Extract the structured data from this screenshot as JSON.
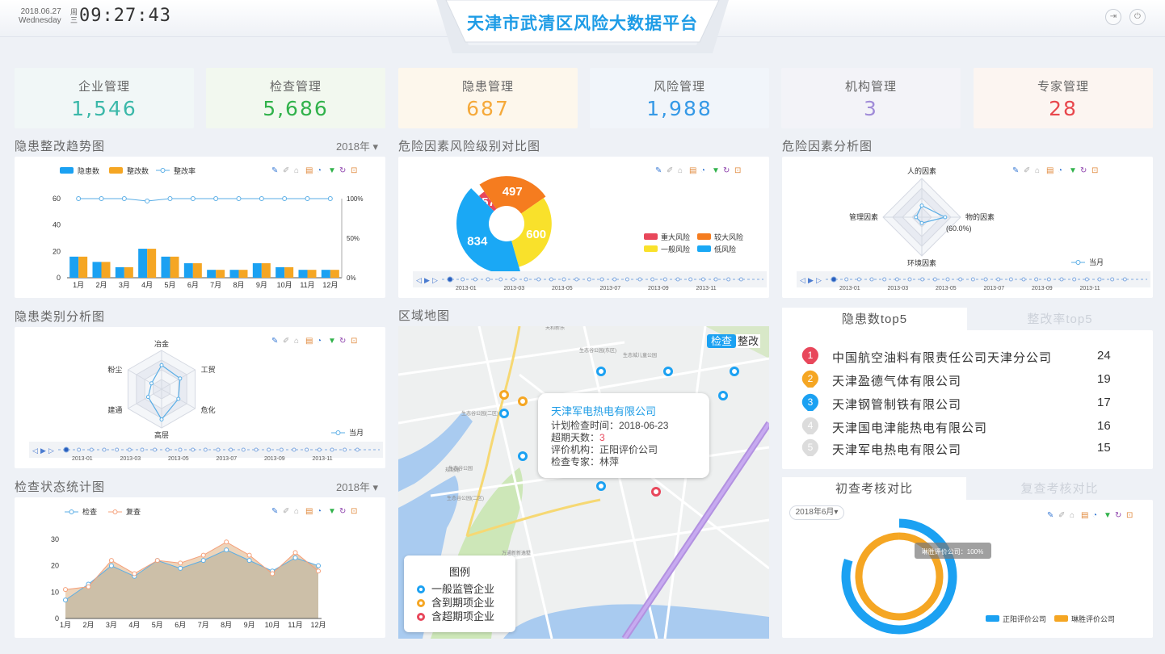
{
  "header": {
    "date": "2018.06.27",
    "weekday_en": "Wednesday",
    "weekday_cn": "周三",
    "time": "09:27:43",
    "title": "天津市武清区风险大数据平台"
  },
  "stats": [
    {
      "label": "企业管理",
      "value": "1,546",
      "color": "#3bb8a9",
      "bg": "#f1f7f7"
    },
    {
      "label": "检查管理",
      "value": "5,686",
      "color": "#31b24b",
      "bg": "#f2f8ef"
    },
    {
      "label": "隐患管理",
      "value": "687",
      "color": "#f5a93a",
      "bg": "#fdf7ec"
    },
    {
      "label": "风险管理",
      "value": "1,988",
      "color": "#3599e6",
      "bg": "#f1f5fa"
    },
    {
      "label": "机构管理",
      "value": "3",
      "color": "#a08bd8",
      "bg": "#f3f3f8"
    },
    {
      "label": "专家管理",
      "value": "28",
      "color": "#e8474d",
      "bg": "#fcf5f1"
    }
  ],
  "sections": {
    "trend": "隐患整改趋势图",
    "trend_year": "2018年",
    "risk_level": "危险因素风险级别对比图",
    "factor": "危险因素分析图",
    "category": "隐患类别分析图",
    "area_map": "区域地图",
    "inspect": "检查状态统计图",
    "inspect_year": "2018年"
  },
  "timeline_ticks": [
    "2013-01",
    "2013-03",
    "2013-05",
    "2013-07",
    "2013-09",
    "2013-11"
  ],
  "chart_data": [
    {
      "type": "bar",
      "title": "",
      "categories": [
        "1月",
        "2月",
        "3月",
        "4月",
        "5月",
        "6月",
        "7月",
        "8月",
        "9月",
        "10月",
        "11月",
        "12月"
      ],
      "series": [
        {
          "name": "隐患数",
          "values": [
            16,
            12,
            8,
            22,
            16,
            11,
            6,
            6,
            11,
            8,
            6,
            6
          ],
          "color": "#1ba1f2"
        },
        {
          "name": "整改数",
          "values": [
            16,
            12,
            8,
            22,
            16,
            11,
            6,
            6,
            11,
            8,
            6,
            6
          ],
          "color": "#f5a623"
        },
        {
          "name": "整改率",
          "type": "line",
          "axis": "right",
          "values": [
            100,
            100,
            100,
            97,
            100,
            100,
            100,
            100,
            100,
            100,
            100,
            100
          ],
          "color": "#5aaee6"
        }
      ],
      "y_ticks": [
        0,
        20,
        40,
        60
      ],
      "ylim": [
        0,
        60
      ],
      "y2_ticks": [
        "0%",
        "50%",
        "100%"
      ],
      "y2lim": [
        0,
        100
      ],
      "legend": "top-center"
    },
    {
      "type": "pie",
      "title": "",
      "slices": [
        {
          "name": "重大风险",
          "value": 57,
          "color": "#e8475b"
        },
        {
          "name": "较大风险",
          "value": 497,
          "color": "#f57c1f"
        },
        {
          "name": "一般风险",
          "value": 600,
          "color": "#f9e12b"
        },
        {
          "name": "低风险",
          "value": 834,
          "color": "#1aa8f5"
        }
      ],
      "legend": "right"
    },
    {
      "type": "radar",
      "title": "",
      "indicators": [
        "人的因素",
        "物的因素",
        "环境因素",
        "管理因素"
      ],
      "annotation": "(60.0%)",
      "series": [
        {
          "name": "当月",
          "values": [
            0.3,
            0.6,
            0.15,
            0.15
          ]
        }
      ],
      "legend": "bottom-right"
    },
    {
      "type": "radar",
      "title": "",
      "indicators": [
        "冶金",
        "工贸",
        "危化",
        "高层",
        "建通",
        "粉尘"
      ],
      "series": [
        {
          "name": "当月",
          "values": [
            0.62,
            0.55,
            0.5,
            0.78,
            0.4,
            0.3
          ]
        }
      ],
      "legend": "bottom-right"
    },
    {
      "type": "area",
      "title": "",
      "categories": [
        "1月",
        "2月",
        "3月",
        "4月",
        "5月",
        "6月",
        "7月",
        "8月",
        "9月",
        "10月",
        "11月",
        "12月"
      ],
      "series": [
        {
          "name": "检查",
          "values": [
            7,
            13,
            20,
            16,
            22,
            19,
            22,
            26,
            22,
            18,
            23,
            20
          ],
          "color": "#5aaee6"
        },
        {
          "name": "复查",
          "values": [
            11,
            12,
            22,
            17,
            22,
            21,
            24,
            29,
            24,
            17,
            25,
            18
          ],
          "color": "#f5a07a"
        }
      ],
      "y_ticks": [
        0,
        10,
        20,
        30
      ],
      "ylim": [
        0,
        30
      ],
      "legend": "top-left"
    },
    {
      "type": "pie",
      "title": "",
      "slices": [
        {
          "name": "正阳评价公司",
          "value": 80,
          "color": "#1ba1f2"
        },
        {
          "name": "琳胜评价公司",
          "value": 100,
          "color": "#f5a623"
        }
      ],
      "tooltip": "琳胜评价公司：100%",
      "legend": "bottom-right"
    }
  ],
  "top5_tabs": {
    "active": "隐患数top5",
    "inactive": "整改率top5"
  },
  "top5": [
    {
      "rank": "1",
      "name": "中国航空油料有限责任公司天津分公司",
      "value": "24",
      "color": "#e8475b"
    },
    {
      "rank": "2",
      "name": "天津盈德气体有限公司",
      "value": "19",
      "color": "#f5a623"
    },
    {
      "rank": "3",
      "name": "天津钢管制铁有限公司",
      "value": "17",
      "color": "#1ba1f2"
    },
    {
      "rank": "4",
      "name": "天津国电津能热电有限公司",
      "value": "16",
      "color": "#dcdcdc"
    },
    {
      "rank": "5",
      "name": "天津军电热电有限公司",
      "value": "15",
      "color": "#dcdcdc"
    }
  ],
  "audit_tabs": {
    "active": "初查考核对比",
    "inactive": "复查考核对比"
  },
  "audit_month": "2018年6月",
  "map": {
    "toggle_check": "检查",
    "toggle_rectify": "整改",
    "popup": {
      "company": "天津军电热电有限公司",
      "plan_label": "计划检查时间：",
      "plan_value": "2018-06-23",
      "overdue_label": "超期天数：",
      "overdue_value": "3",
      "agency_label": "评价机构：",
      "agency_value": "正阳评价公司",
      "expert_label": "检查专家：",
      "expert_value": "林萍"
    },
    "legend_title": "图例",
    "legend": [
      {
        "label": "一般监管企业",
        "color": "#1ba1f2"
      },
      {
        "label": "含到期项企业",
        "color": "#f5a623"
      },
      {
        "label": "含超期项企业",
        "color": "#e8475b"
      }
    ],
    "place_labels": [
      "天和新乐",
      "生态谷公园(东区)",
      "生态城儿童公园",
      "生态谷公园(二区)",
      "生态谷公园",
      "规划路",
      "生态谷公园(二区)",
      "万通新新逸墅"
    ]
  }
}
